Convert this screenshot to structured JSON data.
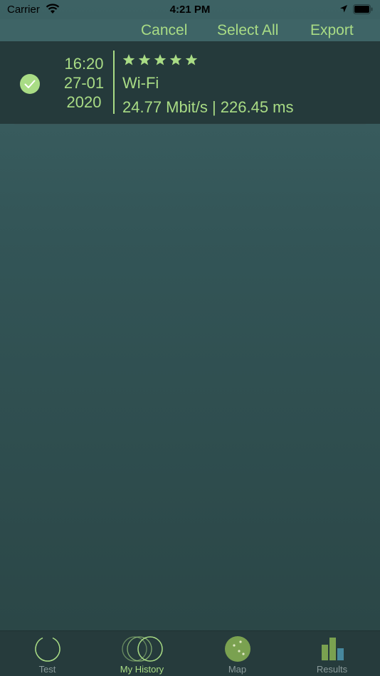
{
  "status_bar": {
    "carrier": "Carrier",
    "time": "4:21 PM"
  },
  "nav": {
    "cancel": "Cancel",
    "select_all": "Select All",
    "export": "Export"
  },
  "history": [
    {
      "time": "16:20",
      "date": "27-01",
      "year": "2020",
      "rating": 5,
      "connection": "Wi-Fi",
      "metrics": "24.77 Mbit/s | 226.45 ms",
      "selected": true
    }
  ],
  "tabs": [
    {
      "label": "Test",
      "icon": "test-icon",
      "active": false
    },
    {
      "label": "My History",
      "icon": "history-icon",
      "active": true
    },
    {
      "label": "Map",
      "icon": "map-icon",
      "active": false
    },
    {
      "label": "Results",
      "icon": "results-icon",
      "active": false
    }
  ],
  "colors": {
    "accent": "#a9dc85",
    "background": "#335557",
    "row_background": "#253a3b",
    "tab_inactive": "#8a9a9a"
  }
}
